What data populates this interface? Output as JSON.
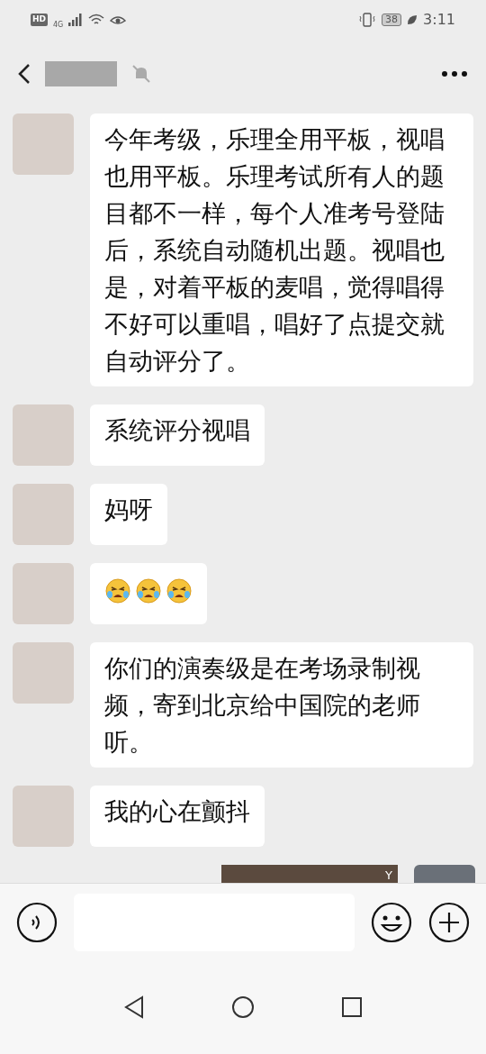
{
  "status_bar": {
    "hd": "HD",
    "network": "4G",
    "battery": "38",
    "time": "3:11"
  },
  "header": {
    "muted": true
  },
  "messages": [
    {
      "kind": "text",
      "outgoing": false,
      "text": "今年考级，乐理全用平板，视唱也用平板。乐理考试所有人的题目都不一样，每个人准考号登陆后，系统自动随机出题。视唱也是，对着平板的麦唱，觉得唱得不好可以重唱，唱好了点提交就自动评分了。"
    },
    {
      "kind": "text",
      "outgoing": false,
      "text": "系统评分视唱"
    },
    {
      "kind": "text",
      "outgoing": false,
      "text": "妈呀"
    },
    {
      "kind": "emoji",
      "outgoing": false,
      "emojis": [
        {
          "kind": "crying"
        },
        {
          "kind": "crying"
        },
        {
          "kind": "crying"
        }
      ]
    },
    {
      "kind": "text",
      "outgoing": false,
      "text": "你们的演奏级是在考场录制视频，寄到北京给中国院的老师听。"
    },
    {
      "kind": "text",
      "outgoing": false,
      "text": "我的心在颤抖"
    },
    {
      "kind": "video",
      "outgoing": true,
      "badge": "Y"
    }
  ]
}
